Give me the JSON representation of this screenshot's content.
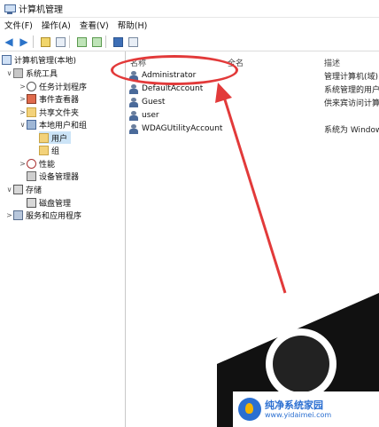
{
  "window": {
    "title": "计算机管理"
  },
  "menu": [
    "文件(F)",
    "操作(A)",
    "查看(V)",
    "帮助(H)"
  ],
  "tree": [
    {
      "label": "计算机管理(本地)",
      "indent": 0,
      "twisty": "",
      "icon": "pc"
    },
    {
      "label": "系统工具",
      "indent": 1,
      "twisty": "∨",
      "icon": "tool"
    },
    {
      "label": "任务计划程序",
      "indent": 2,
      "twisty": ">",
      "icon": "clock"
    },
    {
      "label": "事件查看器",
      "indent": 2,
      "twisty": ">",
      "icon": "log"
    },
    {
      "label": "共享文件夹",
      "indent": 2,
      "twisty": ">",
      "icon": "folder"
    },
    {
      "label": "本地用户和组",
      "indent": 2,
      "twisty": "∨",
      "icon": "users"
    },
    {
      "label": "用户",
      "indent": 3,
      "twisty": "",
      "icon": "folder",
      "selected": true
    },
    {
      "label": "组",
      "indent": 3,
      "twisty": "",
      "icon": "folder"
    },
    {
      "label": "性能",
      "indent": 2,
      "twisty": ">",
      "icon": "perf"
    },
    {
      "label": "设备管理器",
      "indent": 2,
      "twisty": "",
      "icon": "device"
    },
    {
      "label": "存储",
      "indent": 1,
      "twisty": "∨",
      "icon": "disk"
    },
    {
      "label": "磁盘管理",
      "indent": 2,
      "twisty": "",
      "icon": "disk"
    },
    {
      "label": "服务和应用程序",
      "indent": 1,
      "twisty": ">",
      "icon": "svc"
    }
  ],
  "columns": {
    "name": "名称",
    "fullname": "全名",
    "desc": "描述"
  },
  "users": [
    {
      "name": "Administrator",
      "desc": "管理计算机(域)"
    },
    {
      "name": "DefaultAccount",
      "desc": "系统管理的用户"
    },
    {
      "name": "Guest",
      "desc": "供来宾访问计算"
    },
    {
      "name": "user",
      "desc": ""
    },
    {
      "name": "WDAGUtilityAccount",
      "desc": "系统为 Window"
    }
  ],
  "watermark": {
    "name": "纯净系统家园",
    "url": "www.yidaimei.com"
  },
  "colors": {
    "highlight": "#e23a3a",
    "selection": "#cce4f7"
  }
}
